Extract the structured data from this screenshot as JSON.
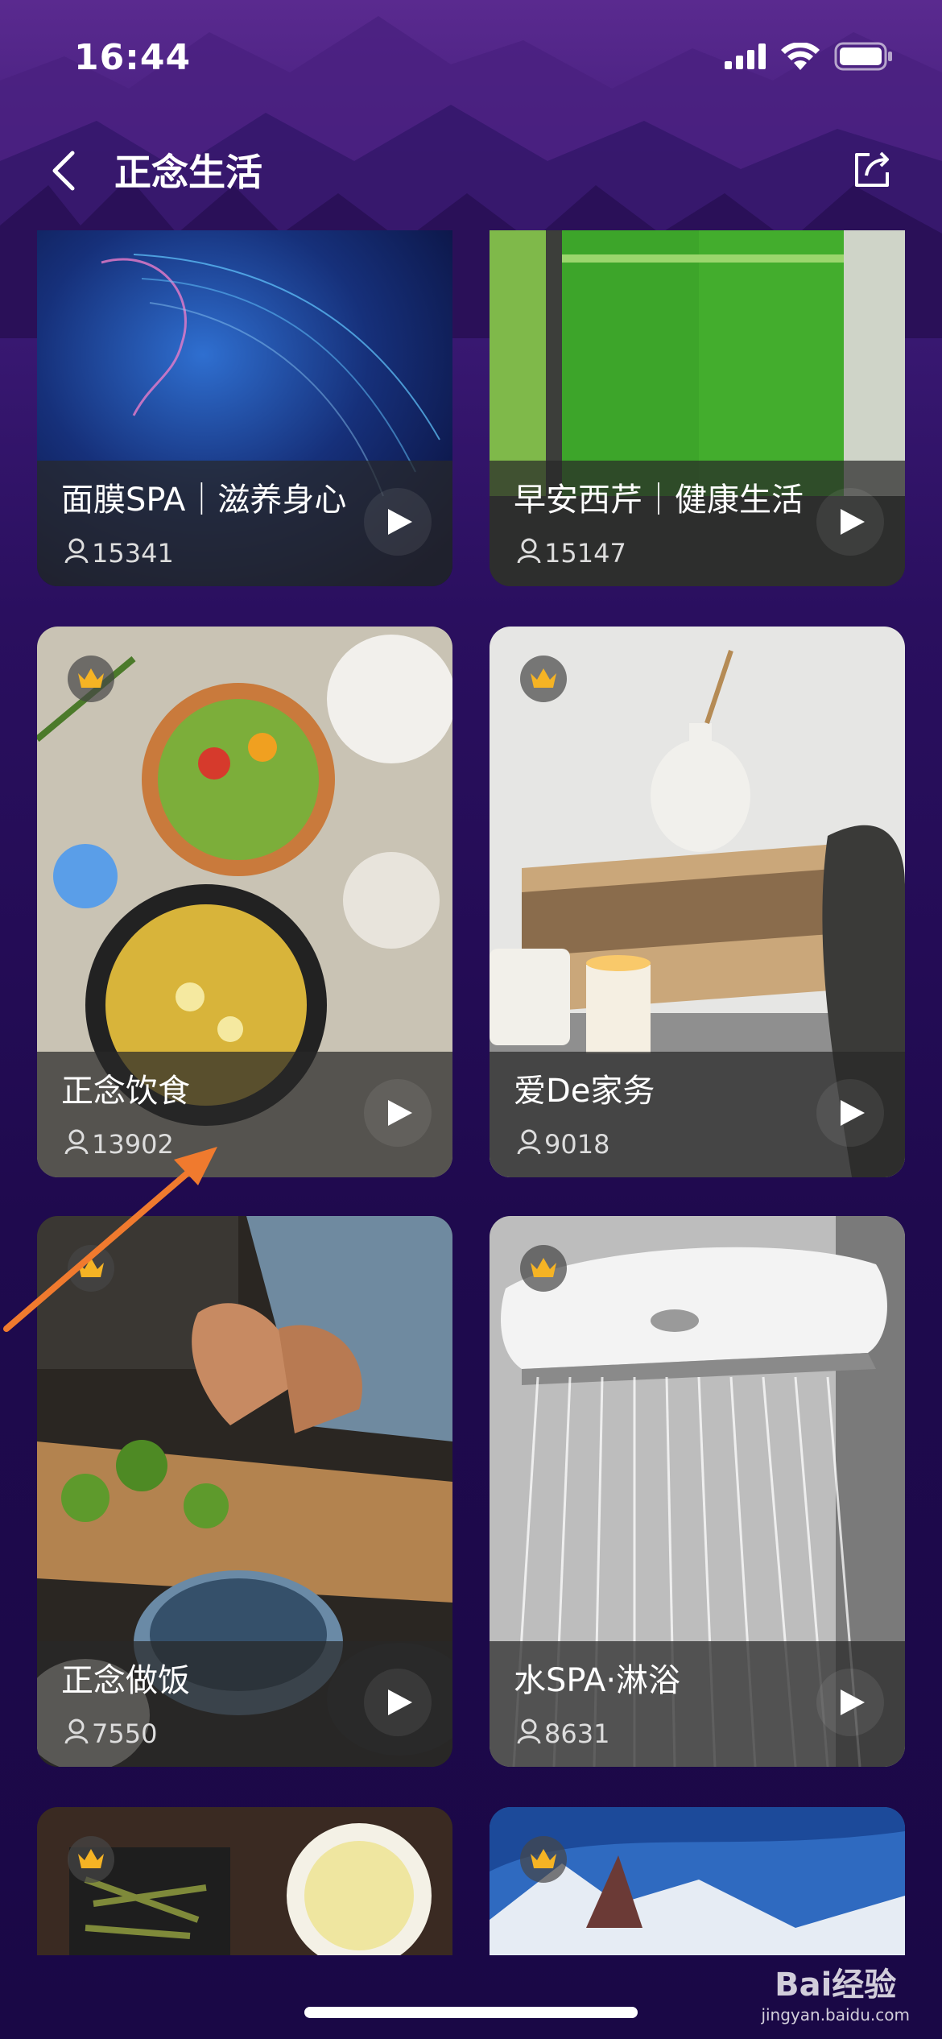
{
  "status_bar": {
    "time": "16:44"
  },
  "nav": {
    "title": "正念生活"
  },
  "cards": [
    {
      "title": "面膜SPA｜滋养身心",
      "count": "15341",
      "premium": false
    },
    {
      "title": "早安西芹｜健康生活",
      "count": "15147",
      "premium": false
    },
    {
      "title": "正念饮食",
      "count": "13902",
      "premium": true
    },
    {
      "title": "爱De家务",
      "count": "9018",
      "premium": true
    },
    {
      "title": "正念做饭",
      "count": "7550",
      "premium": true
    },
    {
      "title": "水SPA·淋浴",
      "count": "8631",
      "premium": true
    },
    {
      "title": "",
      "count": "",
      "premium": true
    },
    {
      "title": "",
      "count": "",
      "premium": true
    }
  ],
  "watermark": {
    "brand": "Bai经验",
    "url": "jingyan.baidu.com"
  },
  "colors": {
    "accent_arrow": "#f07a2e",
    "background": "#2a0f5f",
    "crown": "#f5b324"
  }
}
